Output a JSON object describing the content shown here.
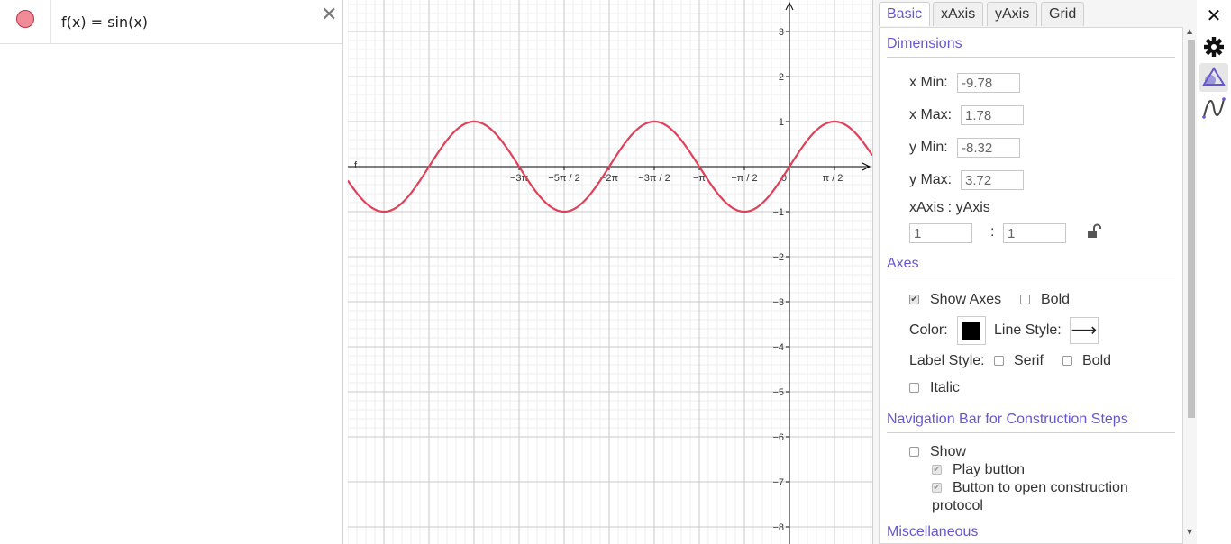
{
  "algebra": {
    "formula": "f(x) = sin(x)",
    "marble_color": "#f08c98"
  },
  "graphics": {
    "curve_label": "f",
    "curve_color": "#e0405a",
    "x_range": [
      -9.78,
      1.78
    ],
    "y_range": [
      -8.32,
      3.72
    ],
    "x_tick_labels": [
      "−3π",
      "−5π / 2",
      "−2π",
      "−3π / 2",
      "−π",
      "−π / 2",
      "0",
      "π / 2"
    ],
    "y_tick_labels": [
      "3",
      "2",
      "1",
      "−1",
      "−2",
      "−3",
      "−4",
      "−5",
      "−6",
      "−7",
      "−8"
    ]
  },
  "properties": {
    "tabs": [
      "Basic",
      "xAxis",
      "yAxis",
      "Grid"
    ],
    "active_tab": "Basic",
    "dimensions": {
      "title": "Dimensions",
      "xmin_label": "x Min:",
      "xmin": "-9.78",
      "xmax_label": "x Max:",
      "xmax": "1.78",
      "ymin_label": "y Min:",
      "ymin": "-8.32",
      "ymax_label": "y Max:",
      "ymax": "3.72",
      "ratio_label": "xAxis : yAxis",
      "ratio_x": "1",
      "ratio_sep": ":",
      "ratio_y": "1"
    },
    "axes": {
      "title": "Axes",
      "show_axes": "Show Axes",
      "bold": "Bold",
      "color_label": "Color:",
      "color": "#000000",
      "line_style_label": "Line Style:",
      "line_style_glyph": "⟶",
      "label_style": "Label Style:",
      "serif": "Serif",
      "bold2": "Bold",
      "italic": "Italic"
    },
    "navbar": {
      "title": "Navigation Bar for Construction Steps",
      "show": "Show",
      "play": "Play button",
      "open_protocol_1": "Button to open construction",
      "open_protocol_2": "protocol"
    },
    "misc": {
      "title": "Miscellaneous"
    }
  },
  "toolbar": {
    "close_glyph": "✕",
    "icons": [
      "close-icon",
      "gear-icon",
      "graphics-style-icon",
      "function-style-icon"
    ]
  },
  "accent_color": "#6557d2"
}
